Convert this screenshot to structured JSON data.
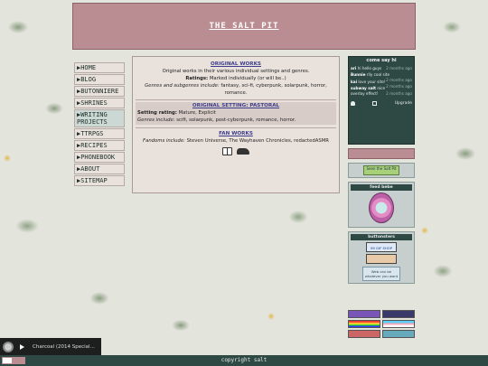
{
  "header": {
    "title": "THE SALT PIT"
  },
  "nav": {
    "items": [
      {
        "label": "HOME"
      },
      {
        "label": "BLOG"
      },
      {
        "label": "BUTONNIERE"
      },
      {
        "label": "SHRINES"
      },
      {
        "label": "WRITING PROJECTS"
      },
      {
        "label": "TTRPGS"
      },
      {
        "label": "RECIPES"
      },
      {
        "label": "PHONEBOOK"
      },
      {
        "label": "ABOUT"
      },
      {
        "label": "SITEMAP"
      }
    ]
  },
  "main": {
    "original_works": {
      "title": "ORIGINAL WORKS",
      "desc": "Original works in their various individual settings and genres.",
      "ratings_label": "Ratings:",
      "ratings_value": "Marked individually (or will be..)",
      "genres_label": "Genres and subgenres include:",
      "genres_value": "fantasy, sci-fi, cyberpunk, solarpunk, horror, romance."
    },
    "pastoral": {
      "title": "ORIGINAL SETTING: PASTORAL",
      "rating_label": "Setting rating:",
      "rating_value": "Mature, Explicit",
      "genres_label": "Genres include:",
      "genres_value": "scifi, solarpunk, post-cyberpunk, romance, horror."
    },
    "fan_works": {
      "title": "FAN WORKS",
      "fandoms_label": "Fandoms include:",
      "fandoms_value": "Steven Universe, The Wayhaven Chronicles, redactedASMR"
    }
  },
  "chat": {
    "title": "come say hi",
    "messages": [
      {
        "name": "ari",
        "text": "hi hello guys",
        "time": "2 months ago"
      },
      {
        "name": "Bunnie",
        "text": "rlly cool site",
        "time": "2 months ago"
      },
      {
        "name": "kai",
        "text": "love your site!",
        "time": "2 months ago"
      },
      {
        "name": "subway salt",
        "text": "nice overlay effect!",
        "time": "2 months ago"
      }
    ],
    "upgrade_label": "Upgrade"
  },
  "widgets": {
    "badge_button": "Seen the Salt Pit",
    "feed_title": "feed bebe",
    "buttons_title": "buttonsters",
    "button_1": "99 GIF SHOP",
    "button_2": "",
    "msg_box": "Web can be whatever you want"
  },
  "footer": {
    "copyright": "copyright salt"
  },
  "player": {
    "track": "Charcoal (2014 Special..."
  },
  "colors": {
    "rose": "#b98d92",
    "teal": "#2e4944",
    "panel": "#e8e1dc"
  }
}
